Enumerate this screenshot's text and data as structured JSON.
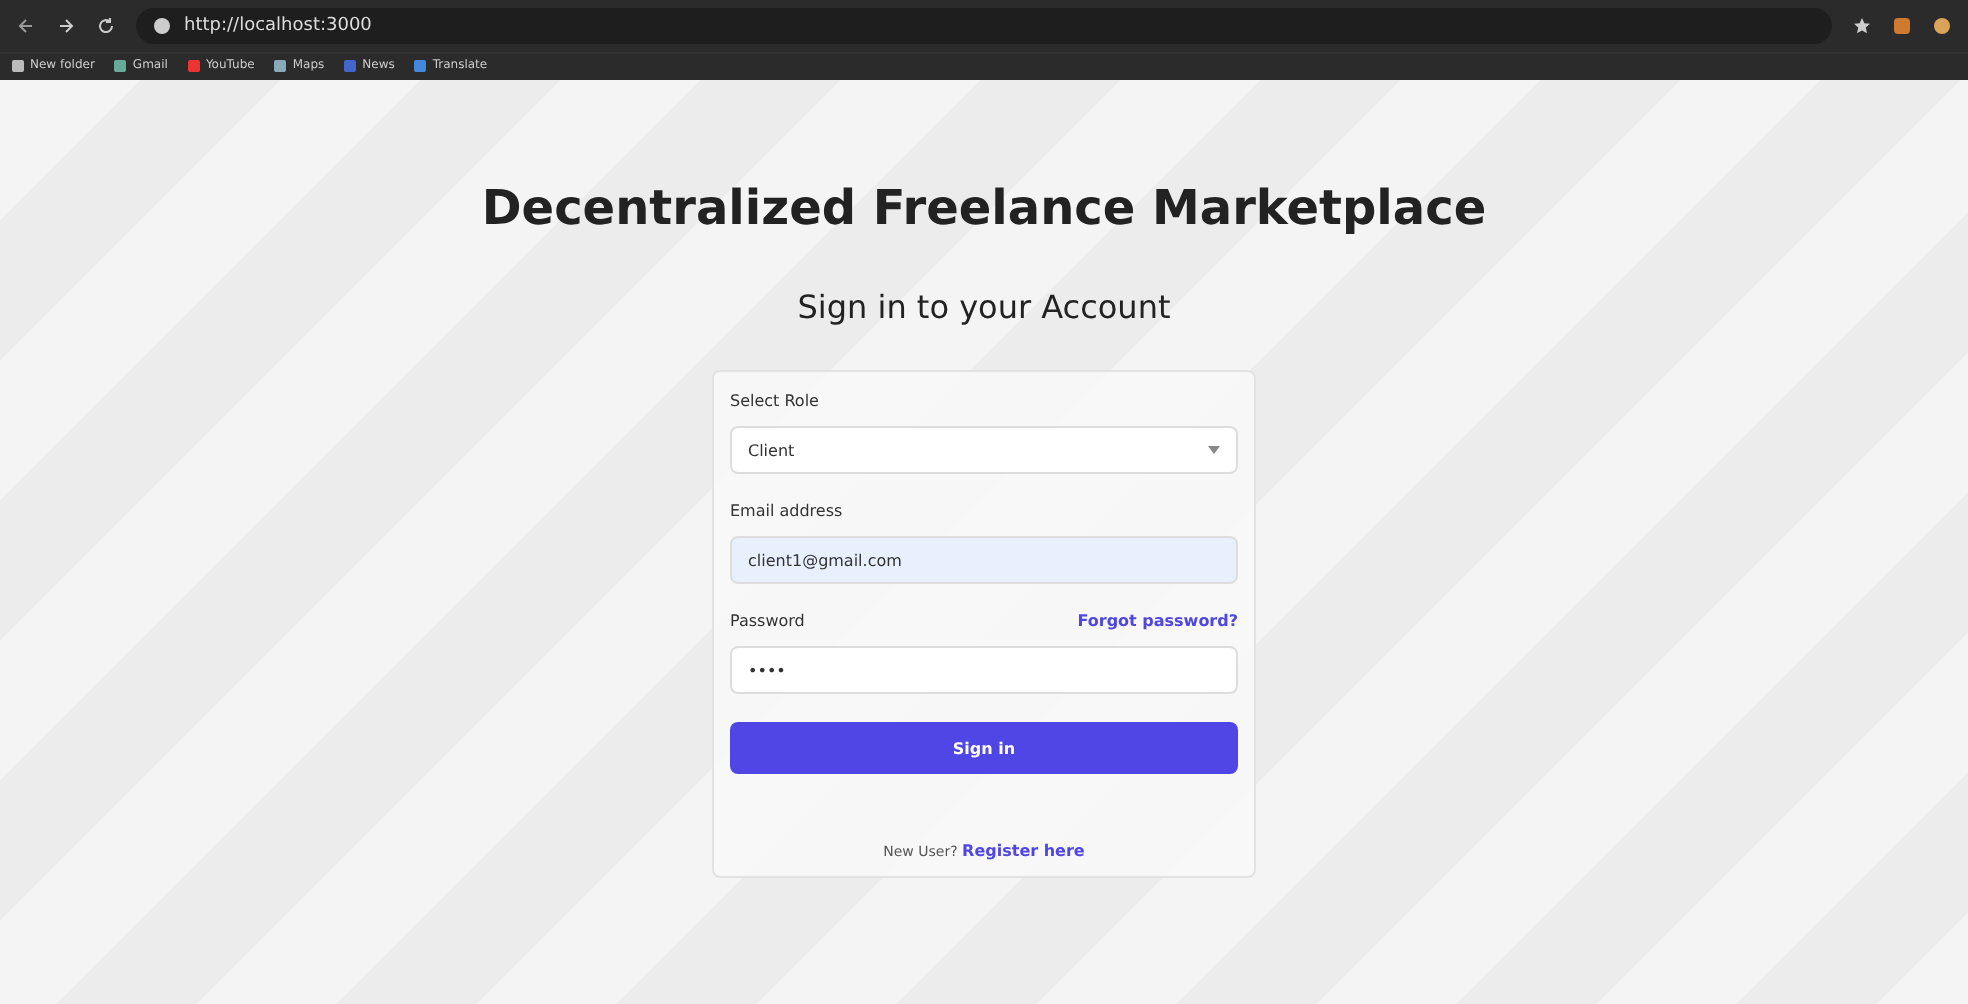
{
  "browser": {
    "url": "http://localhost:3000",
    "bookmarks": [
      {
        "label": "New folder",
        "kind": "folder"
      },
      {
        "label": "Gmail",
        "kind": "mail"
      },
      {
        "label": "YouTube",
        "kind": "video"
      },
      {
        "label": "Maps",
        "kind": "map"
      },
      {
        "label": "News",
        "kind": "news"
      },
      {
        "label": "Translate",
        "kind": "translate"
      }
    ]
  },
  "title": "Decentralized Freelance Marketplace",
  "subtitle": "Sign in to your Account",
  "form": {
    "role_label": "Select Role",
    "role_value": "Client",
    "email_label": "Email address",
    "email_value": "client1@gmail.com",
    "password_label": "Password",
    "forgot_link": "Forgot password?",
    "password_value": "••••",
    "submit": "Sign in",
    "register_prompt": "New User?",
    "register_link": "Register here"
  }
}
